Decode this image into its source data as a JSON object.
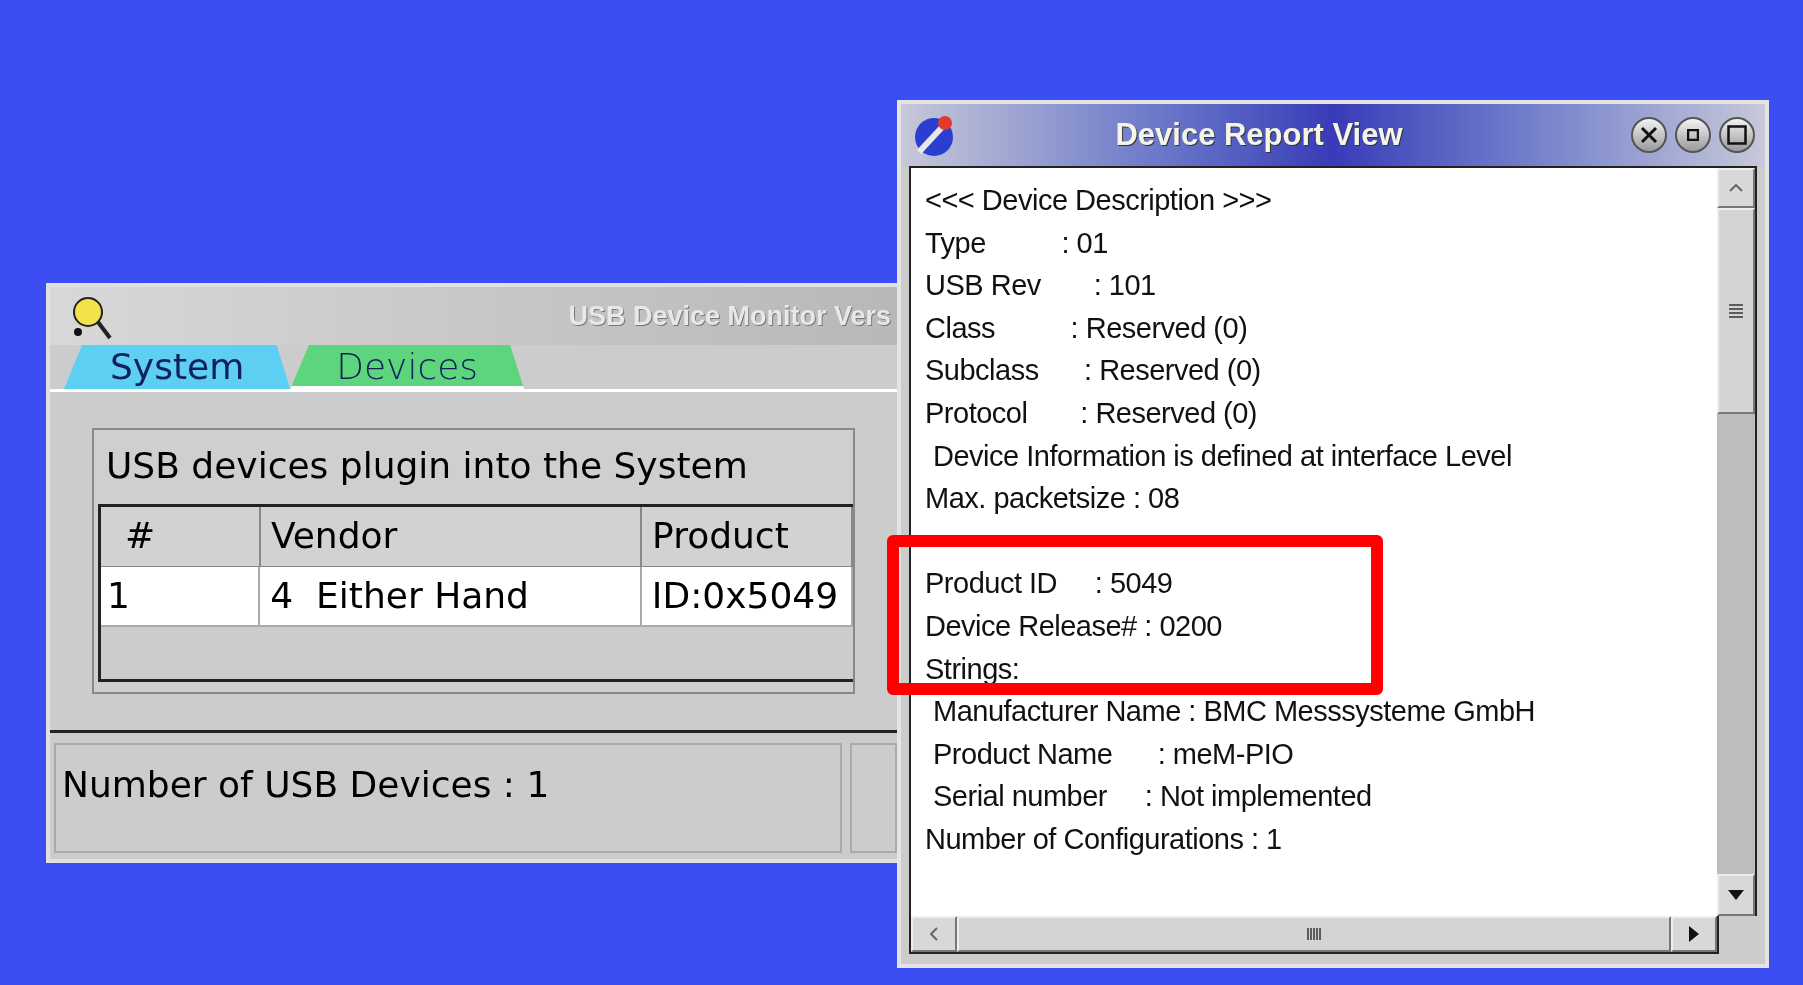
{
  "monitor_window": {
    "title": "USB Device Monitor Vers",
    "tabs": [
      {
        "label": "System",
        "selected": true,
        "color": "#5ccff2"
      },
      {
        "label": "Devices",
        "selected": false,
        "color": "#5cd57c"
      }
    ],
    "group_title": "USB devices plugin into the System",
    "table": {
      "columns": [
        "#",
        "Vendor",
        "Product"
      ],
      "rows": [
        [
          "1",
          "4  Either Hand",
          "ID:0x5049"
        ]
      ]
    },
    "status_bar": "Number of USB Devices : 1"
  },
  "report_window": {
    "title": "Device Report View",
    "lines": [
      {
        "kind": "text",
        "text": "<<< Device Description >>>",
        "indented": false
      },
      {
        "text": "Type          : 01",
        "indented": false
      },
      {
        "text": "USB Rev       : 101",
        "indented": false
      },
      {
        "text": "Class          : Reserved (0)",
        "indented": false
      },
      {
        "text": "Subclass      : Reserved (0)",
        "indented": false
      },
      {
        "text": "Protocol       : Reserved (0)",
        "indented": false
      },
      {
        "text": "Device Information is defined at interface Level",
        "indented": true
      },
      {
        "text": "Max. packetsize : 08",
        "indented": false
      },
      {
        "kind": "covered"
      },
      {
        "text": "Product ID     : 5049",
        "indented": false
      },
      {
        "text": "Device Release# : 0200",
        "indented": false
      },
      {
        "text": "Strings:",
        "indented": false
      },
      {
        "text": "Manufacturer Name : BMC Messsysteme GmbH",
        "indented": true
      },
      {
        "text": "Product Name      : meM-PIO",
        "indented": true
      },
      {
        "text": "Serial number     : Not implemented",
        "indented": true
      },
      {
        "text": "Number of Configurations : 1",
        "indented": false
      }
    ]
  }
}
